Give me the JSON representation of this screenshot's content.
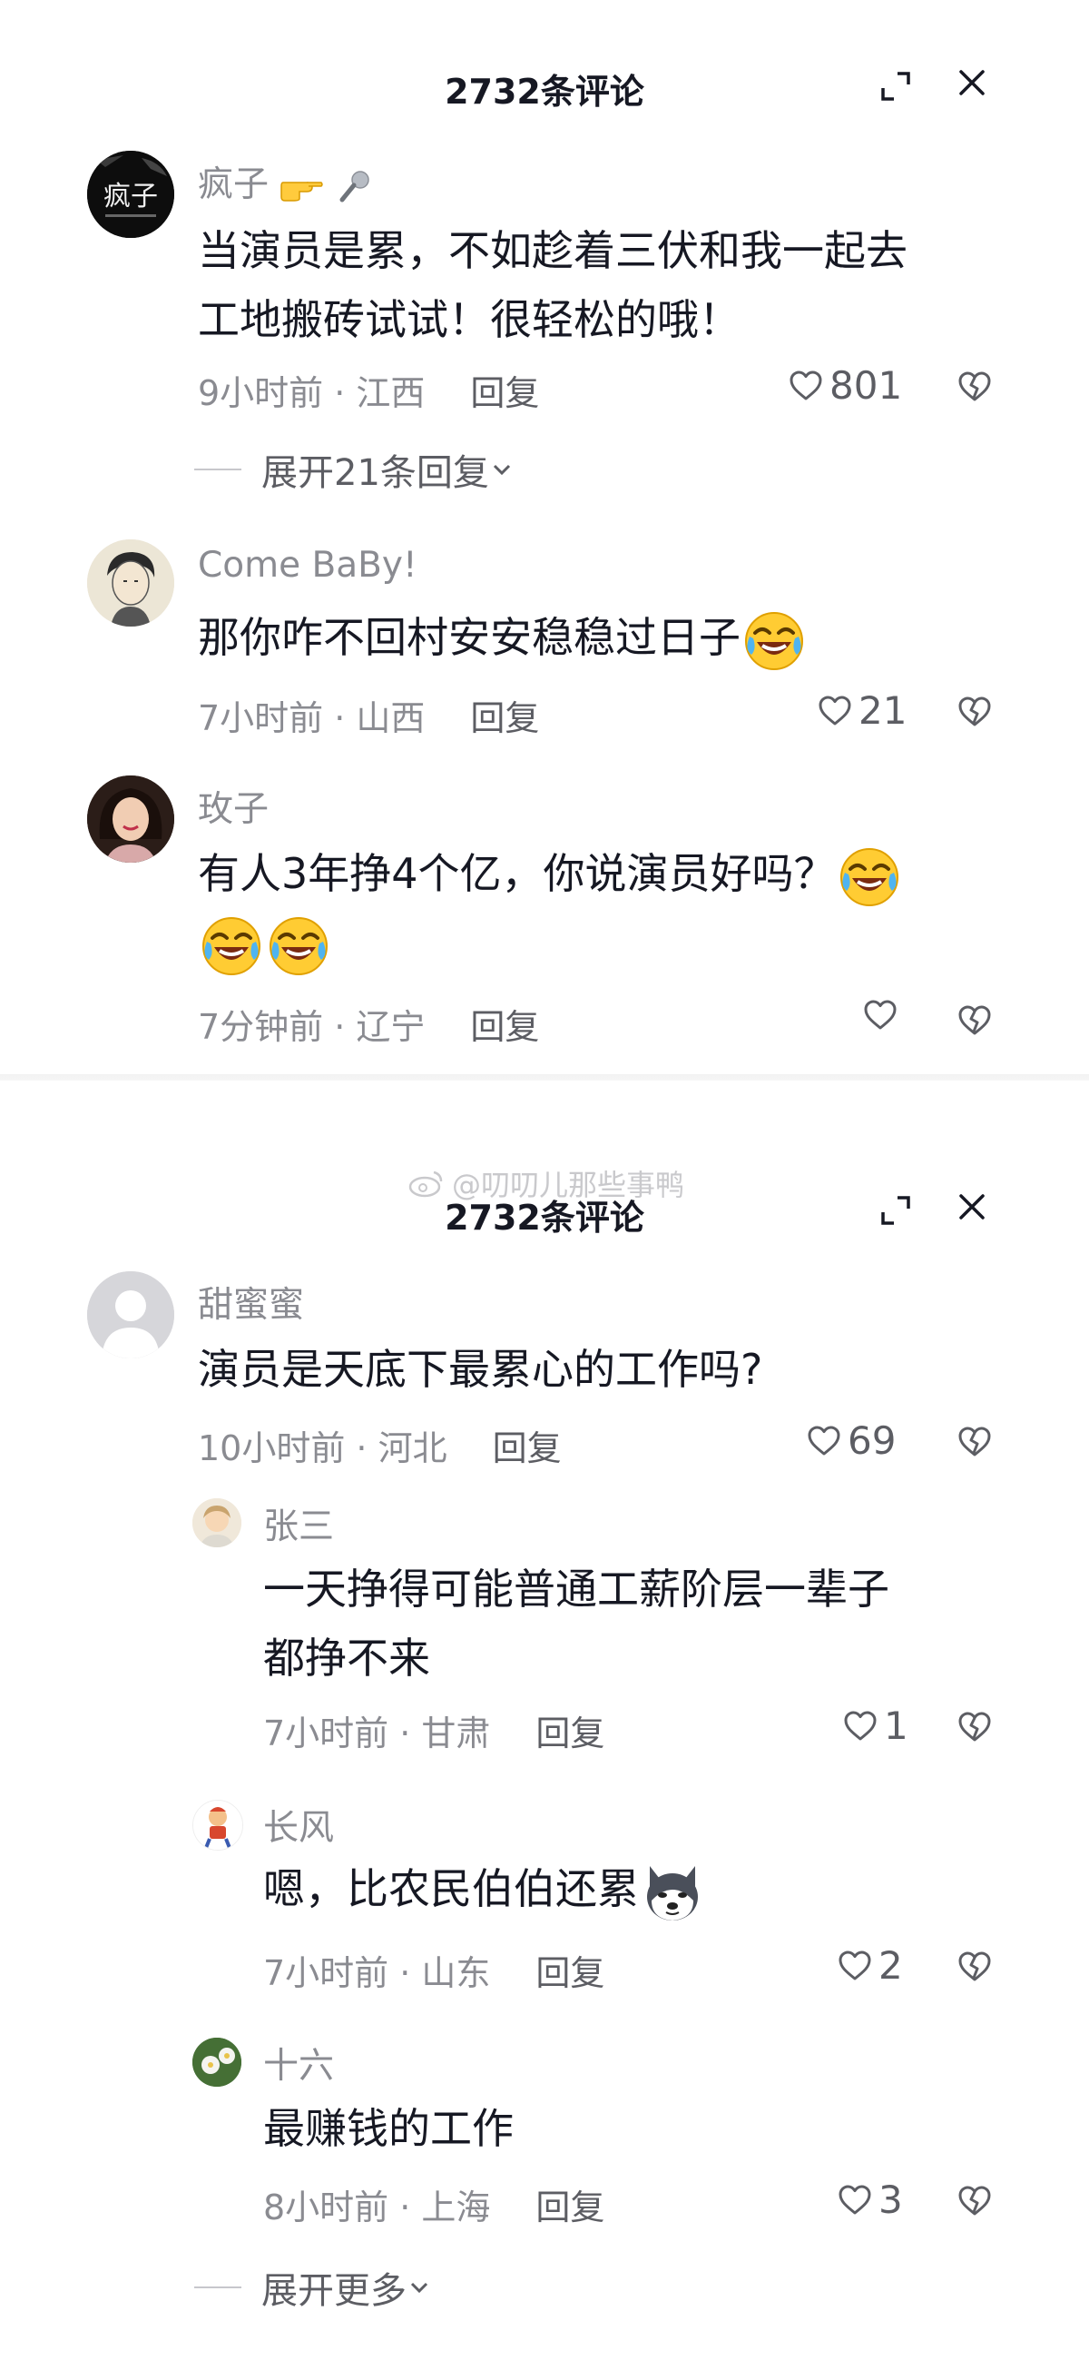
{
  "header": {
    "title": "2732条评论"
  },
  "watermark": "@叨叨儿那些事鸭",
  "panel1": {
    "comments": [
      {
        "username": "疯子",
        "avatar_text": "疯子",
        "lines": [
          "当演员是累，不如趁着三伏和我一起去",
          "工地搬砖试试！很轻松的哦！"
        ],
        "time": "9小时前 · 江西",
        "reply": "回复",
        "likes": "801",
        "expand": "展开21条回复"
      },
      {
        "username": "Come   BaBy!",
        "lines": [
          "那你咋不回村安安稳稳过日子"
        ],
        "time": "7小时前 · 山西",
        "reply": "回复",
        "likes": "21"
      },
      {
        "username": "玫子",
        "lines": [
          "有人3年挣4个亿，你说演员好吗？"
        ],
        "time": "7分钟前 · 辽宁",
        "reply": "回复",
        "likes": ""
      }
    ]
  },
  "panel2": {
    "comment": {
      "username": "甜蜜蜜",
      "text": "演员是天底下最累心的工作吗?",
      "time": "10小时前 · 河北",
      "reply": "回复",
      "likes": "69"
    },
    "replies": [
      {
        "username": "张三",
        "lines": [
          "一天挣得可能普通工薪阶层一辈子",
          "都挣不来"
        ],
        "time": "7小时前 · 甘肃",
        "reply": "回复",
        "likes": "1"
      },
      {
        "username": "长风",
        "text": "嗯，比农民伯伯还累",
        "time": "7小时前 · 山东",
        "reply": "回复",
        "likes": "2"
      },
      {
        "username": "十六",
        "text": "最赚钱的工作",
        "time": "8小时前 · 上海",
        "reply": "回复",
        "likes": "3"
      }
    ],
    "expand": "展开更多"
  },
  "colors": {
    "text": "#161823",
    "muted": "#8a8b91",
    "secondary": "#5c5d63"
  },
  "icons": {
    "header": [
      "expand-icon",
      "close-icon"
    ],
    "comment_actions": [
      "heart-icon",
      "dislike-heart-icon"
    ],
    "emoji": [
      "laugh-cry-emoji",
      "husky-dog-emoji"
    ],
    "name_badges": [
      "pointing-hand-emoji",
      "microphone-emoji"
    ]
  }
}
